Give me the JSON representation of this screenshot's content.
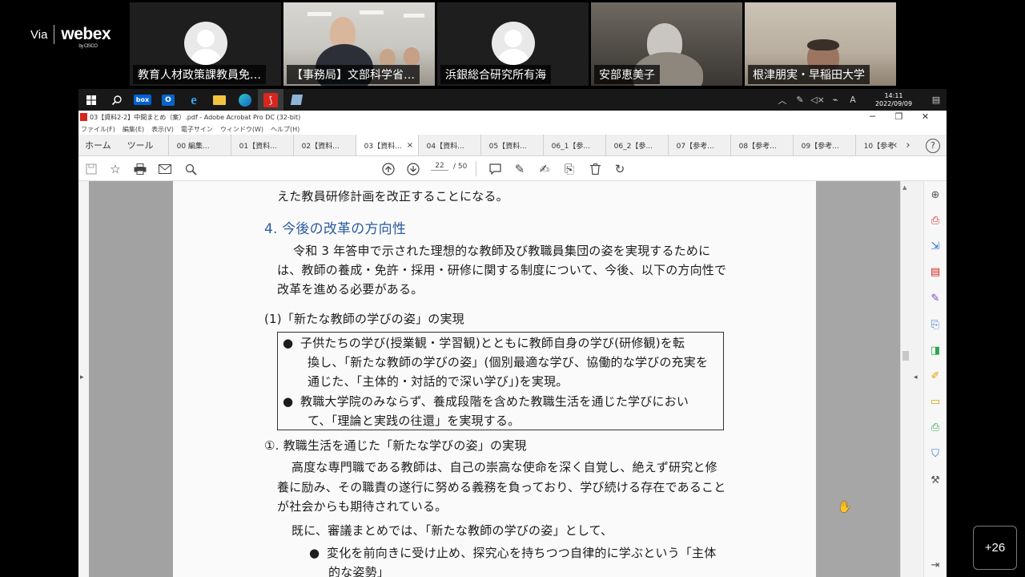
{
  "webex": {
    "via": "Via",
    "brand": "webex",
    "sub": "by CISCO",
    "overflow_count": "+26"
  },
  "participants": [
    {
      "name": "教育人材政策課教員免…"
    },
    {
      "name": "【事務局】文部科学省…"
    },
    {
      "name": "浜銀総合研究所有海"
    },
    {
      "name": "安部恵美子"
    },
    {
      "name": "根津朋実・早稲田大学"
    }
  ],
  "taskbar": {
    "time": "14:11",
    "date": "2022/09/09",
    "box_label": "box",
    "ime": "A"
  },
  "window": {
    "title": "03【資料2-2】中間まとめ（案）.pdf - Adobe Acrobat Pro DC (32-bit)",
    "controls": [
      "─",
      "❐",
      "✕"
    ]
  },
  "menu": [
    "ファイル(F)",
    "編集(E)",
    "表示(V)",
    "電子サイン",
    "ウィンドウ(W)",
    "ヘルプ(H)"
  ],
  "tabs": {
    "home": "ホーム",
    "tools": "ツール",
    "docs": [
      "00 編集...",
      "01【資料...",
      "02【資料...",
      "03【資料...",
      "04【資料...",
      "05【資料...",
      "06_1【参...",
      "06_2【参...",
      "07【参考...",
      "08【参考...",
      "09【参考...",
      "10【参考"
    ],
    "active_index": 3,
    "close": "×"
  },
  "toolbar": {
    "page_current": "22",
    "page_total": "/ 50"
  },
  "doc": {
    "l0": "えた教員研修計画を改正することになる。",
    "h4": "4. 今後の改革の方向性",
    "p1a": "令和 3 年答申で示された理想的な教師及び教職員集団の姿を実現するために",
    "p1b": "は、教師の養成・免許・採用・研修に関する制度について、今後、以下の方向性で",
    "p1c": "改革を進める必要がある。",
    "s1": "(1)「新たな教師の学びの姿」の実現",
    "b1a": "子供たちの学び(授業観・学習観)とともに教師自身の学び(研修観)を転",
    "b1b": "換し、「新たな教師の学びの姿」(個別最適な学び、協働的な学びの充実を",
    "b1c": "通じた、「主体的・対話的で深い学び」)を実現。",
    "b2a": "教職大学院のみならず、養成段階を含めた教職生活を通じた学びにおい",
    "b2b": "て、「理論と実践の往還」を実現する。",
    "s2": "①. 教職生活を通じた「新たな学びの姿」の実現",
    "p2a": "高度な専門職である教師は、自己の崇高な使命を深く自覚し、絶えず研究と修",
    "p2b": "養に励み、その職責の遂行に努める義務を負っており、学び続ける存在であること",
    "p2c": "が社会からも期待されている。",
    "p3": "既に、審議まとめでは、「新たな教師の学びの姿」として、",
    "b3a": "変化を前向きに受け止め、探究心を持ちつつ自律的に学ぶという「主体",
    "b3b": "的な姿勢」",
    "bullet": "●"
  },
  "colors": {
    "heading": "#2c5aa0",
    "acrobat_red": "#d7261d",
    "tile_bg": "#1e1e1e"
  },
  "icons": [
    "windows-icon",
    "search-icon",
    "box-icon",
    "outlook-icon",
    "ie-icon",
    "explorer-icon",
    "edge-icon",
    "acrobat-icon",
    "app-icon",
    "save-icon",
    "star-icon",
    "print-icon",
    "mail-icon",
    "zoom-icon",
    "page-up-icon",
    "page-down-icon",
    "comment-icon",
    "pen-icon",
    "sign-icon",
    "stamp-icon",
    "trash-icon",
    "redo-icon"
  ]
}
